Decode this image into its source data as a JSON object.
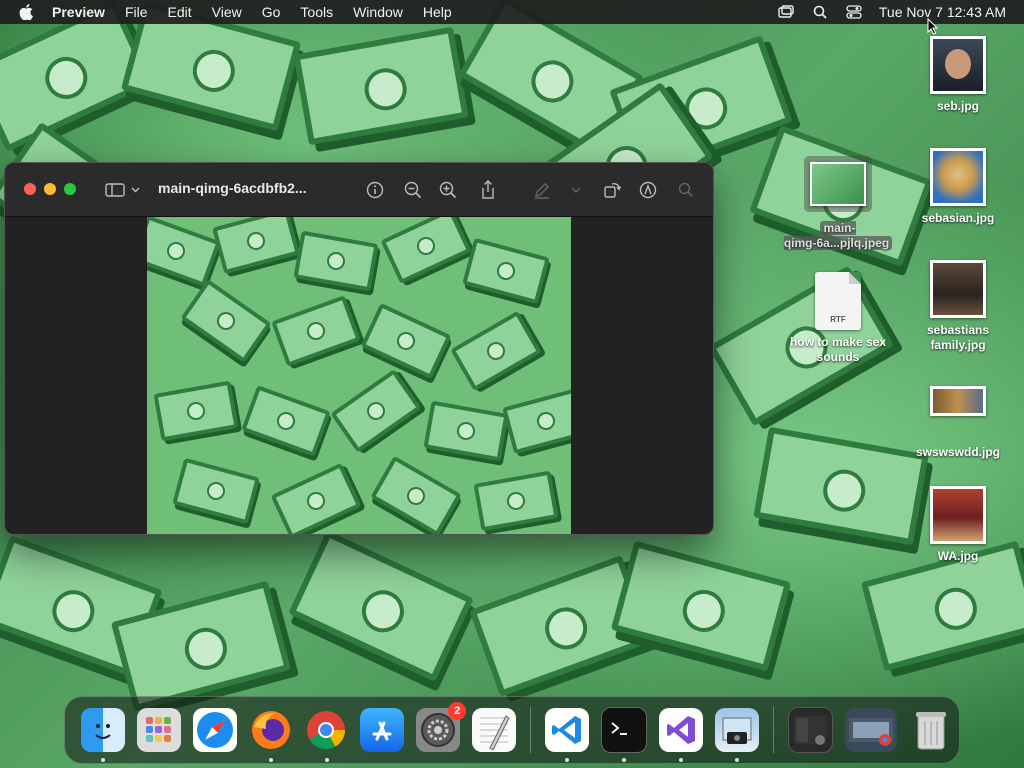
{
  "menubar": {
    "app_name": "Preview",
    "items": [
      "File",
      "Edit",
      "View",
      "Go",
      "Tools",
      "Window",
      "Help"
    ],
    "clock": "Tue Nov 7  12:43 AM"
  },
  "window": {
    "title": "main-qimg-6acdbfb2..."
  },
  "desktop_icons": [
    {
      "label": "seb.jpg"
    },
    {
      "label": "sebasian.jpg"
    },
    {
      "label": "sebastians family.jpg"
    },
    {
      "label": "swswswdd.jpg"
    },
    {
      "label": "WA.jpg"
    },
    {
      "label": "main-\nqimg-6a...pjlq.jpeg"
    },
    {
      "label": "how to make sex sounds",
      "badge": "RTF"
    }
  ],
  "dock": {
    "apps": [
      "Finder",
      "Launchpad",
      "Safari",
      "Firefox",
      "Chrome",
      "App Store",
      "System Settings",
      "TextEdit",
      "Visual Studio Code",
      "Terminal",
      "Visual Studio",
      "Preview",
      "Recent window",
      "Recent window",
      "Trash"
    ],
    "settings_badge": "2"
  },
  "colors": {
    "accent_close": "#ff5f57",
    "accent_min": "#febc2e",
    "accent_max": "#28c840",
    "badge": "#ff3b30"
  }
}
